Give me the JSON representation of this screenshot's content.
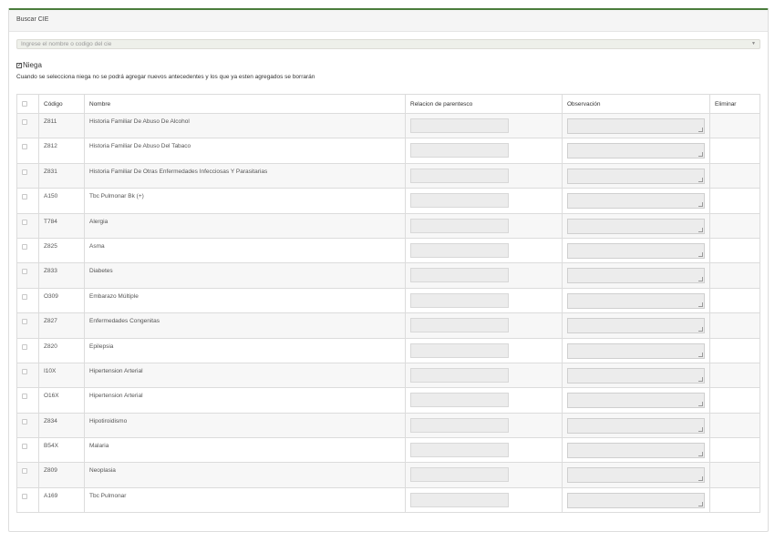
{
  "panel": {
    "title": "Buscar CIE"
  },
  "search": {
    "placeholder": "Ingrese el nombre o codigo del cie",
    "arrow": "▼"
  },
  "niega": {
    "label": "Niega",
    "checked": true
  },
  "note": "Cuando se selecciona niega no se podrá agregar nuevos antecedentes y los que ya esten agregados se borrarán",
  "table": {
    "headers": {
      "codigo": "Código",
      "nombre": "Nombre",
      "relacion": "Relacion de parentesco",
      "observacion": "Observación",
      "eliminar": "Eliminar"
    },
    "rows": [
      {
        "code": "Z811",
        "name": "Historia Familiar De Abuso De Alcohol"
      },
      {
        "code": "Z812",
        "name": "Historia Familiar De Abuso Del Tabaco"
      },
      {
        "code": "Z831",
        "name": "Historia Familiar De Otras Enfermedades Infecciosas Y Parasitarias"
      },
      {
        "code": "A150",
        "name": "Tbc Pulmonar Bk (+)"
      },
      {
        "code": "T784",
        "name": "Alergia"
      },
      {
        "code": "Z825",
        "name": "Asma"
      },
      {
        "code": "Z833",
        "name": "Diabetes"
      },
      {
        "code": "O309",
        "name": "Embarazo Múltiple"
      },
      {
        "code": "Z827",
        "name": "Enfermedades Congenitas"
      },
      {
        "code": "Z820",
        "name": "Epilepsia"
      },
      {
        "code": "I10X",
        "name": "Hipertension Arterial"
      },
      {
        "code": "O16X",
        "name": "Hipertension Arterial"
      },
      {
        "code": "Z834",
        "name": "Hipotiroidismo"
      },
      {
        "code": "B54X",
        "name": "Malaria"
      },
      {
        "code": "Z809",
        "name": "Neoplasia"
      },
      {
        "code": "A169",
        "name": "Tbc Pulmonar"
      }
    ]
  }
}
